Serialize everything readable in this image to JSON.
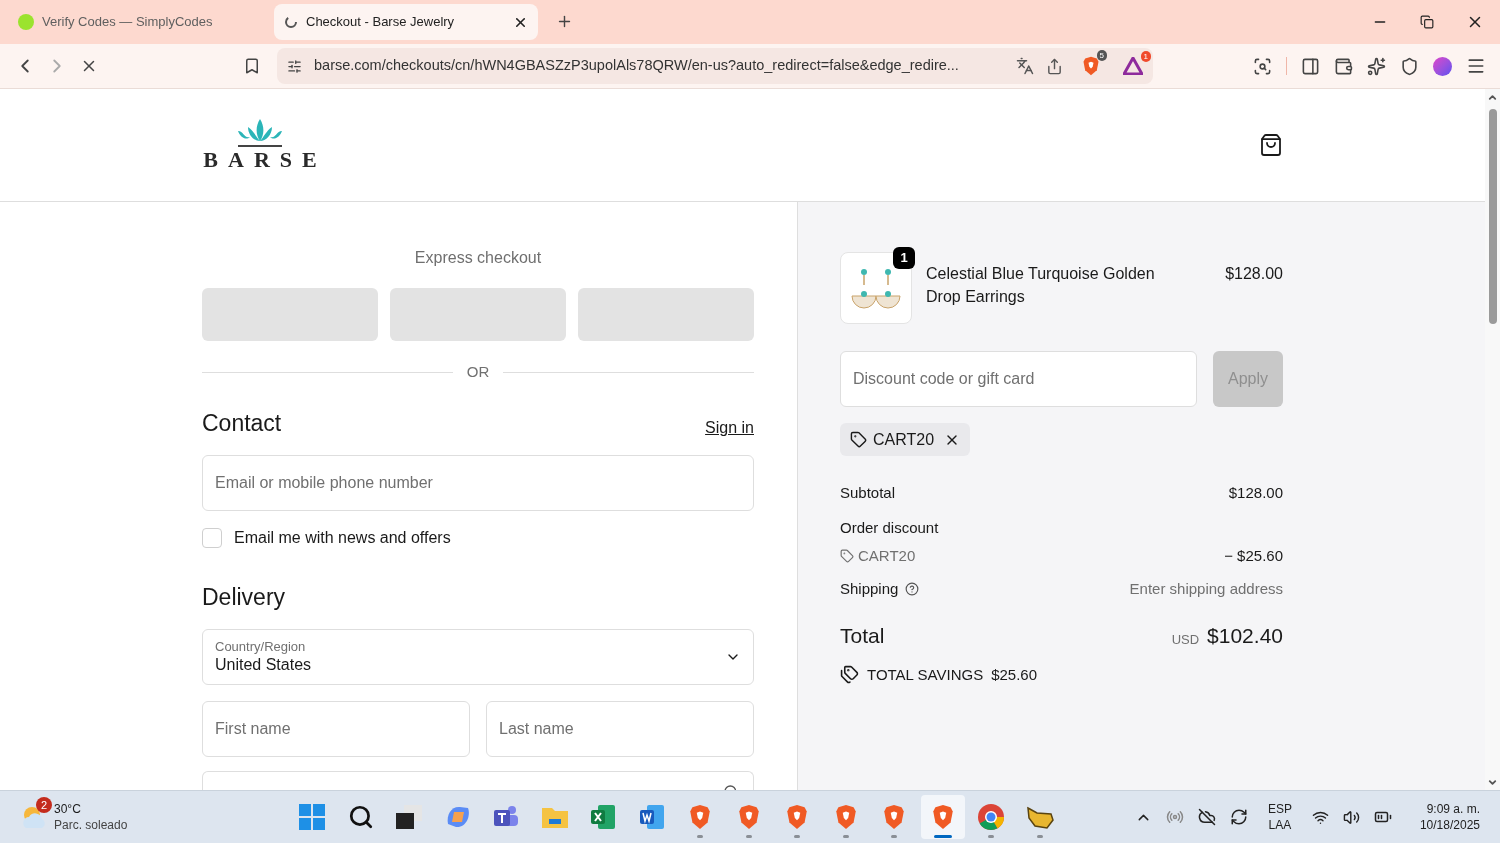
{
  "browser": {
    "tabs": [
      {
        "title": "Verify Codes — SimplyCodes",
        "selected": false
      },
      {
        "title": "Checkout - Barse Jewelry",
        "selected": true
      }
    ],
    "url": "barse.com/checkouts/cn/hWN4GBASZzP3upolAls78QRW/en-us?auto_redirect=false&edge_redire...",
    "shields_badge": "5",
    "rewards_badge": "1",
    "loading": true
  },
  "header": {
    "logo": "BARSE"
  },
  "express_checkout": {
    "title": "Express checkout",
    "buttons": [
      {
        "loading": true
      },
      {
        "loading": true
      },
      {
        "loading": true
      }
    ],
    "divider": "OR"
  },
  "contact": {
    "heading": "Contact",
    "sign_in": "Sign in",
    "email_placeholder": "Email or mobile phone number",
    "newsletter": {
      "label": "Email me with news and offers",
      "checked": false
    }
  },
  "delivery": {
    "heading": "Delivery",
    "country": {
      "label": "Country/Region",
      "value": "United States"
    },
    "first_name_placeholder": "First name",
    "last_name_placeholder": "Last name"
  },
  "summary": {
    "item": {
      "name": "Celestial Blue Turquoise Golden Drop Earrings",
      "price": "$128.00",
      "quantity": "1"
    },
    "discount_placeholder": "Discount code or gift card",
    "apply": {
      "label": "Apply",
      "disabled": true
    },
    "applied_code": "CART20",
    "subtotal": {
      "label": "Subtotal",
      "value": "$128.00"
    },
    "order_discount": {
      "label": "Order discount",
      "code": "CART20",
      "value": "− $25.60"
    },
    "shipping": {
      "label": "Shipping",
      "value": "Enter shipping address"
    },
    "total": {
      "label": "Total",
      "currency": "USD",
      "value": "$102.40"
    },
    "savings": {
      "label": "TOTAL SAVINGS",
      "value": "$25.60"
    }
  },
  "taskbar": {
    "weather": {
      "badge": "2",
      "temperature": "30°C",
      "condition": "Parc. soleado"
    },
    "apps": [
      {
        "kind": "start",
        "running": false,
        "selected": false
      },
      {
        "kind": "search",
        "running": false,
        "selected": false
      },
      {
        "kind": "taskview",
        "running": false,
        "selected": false
      },
      {
        "kind": "copilot",
        "running": false,
        "selected": false
      },
      {
        "kind": "teams",
        "running": false,
        "selected": false
      },
      {
        "kind": "explorer",
        "running": false,
        "selected": false
      },
      {
        "kind": "excel",
        "running": false,
        "selected": false
      },
      {
        "kind": "word",
        "running": false,
        "selected": false
      },
      {
        "kind": "brave",
        "running": true,
        "selected": false
      },
      {
        "kind": "brave",
        "running": true,
        "selected": false
      },
      {
        "kind": "brave",
        "running": true,
        "selected": false
      },
      {
        "kind": "brave",
        "running": true,
        "selected": false
      },
      {
        "kind": "brave",
        "running": true,
        "selected": false
      },
      {
        "kind": "brave",
        "running": true,
        "selected": true
      },
      {
        "kind": "chrome",
        "running": true,
        "selected": false
      },
      {
        "kind": "pointer",
        "running": true,
        "selected": false
      }
    ],
    "language": "ESP",
    "layout": "LAA",
    "time": "9:09 a. m.",
    "date": "10/18/2025"
  }
}
